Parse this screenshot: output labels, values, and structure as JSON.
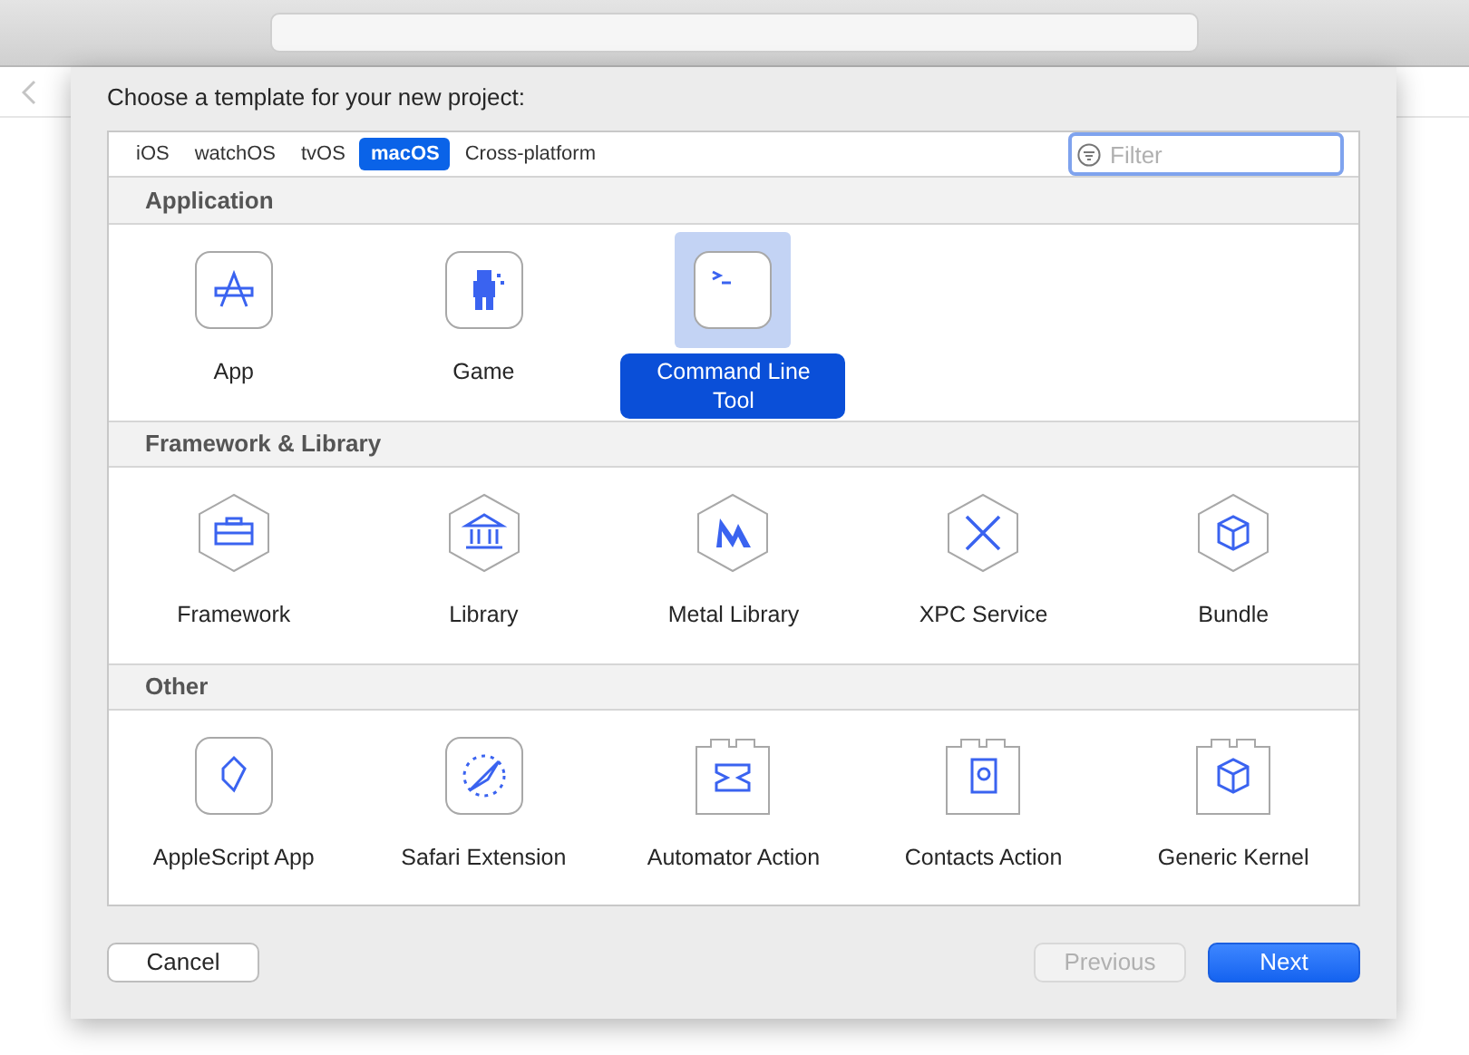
{
  "dialog": {
    "title": "Choose a template for your new project:"
  },
  "tabs": [
    {
      "label": "iOS",
      "selected": false
    },
    {
      "label": "watchOS",
      "selected": false
    },
    {
      "label": "tvOS",
      "selected": false
    },
    {
      "label": "macOS",
      "selected": true
    },
    {
      "label": "Cross-platform",
      "selected": false
    }
  ],
  "filter": {
    "placeholder": "Filter"
  },
  "sections": [
    {
      "title": "Application",
      "items": [
        {
          "label": "App",
          "kind": "rounded",
          "selected": false
        },
        {
          "label": "Game",
          "kind": "rounded",
          "selected": false
        },
        {
          "label": "Command Line Tool",
          "kind": "rounded",
          "selected": true
        }
      ]
    },
    {
      "title": "Framework & Library",
      "items": [
        {
          "label": "Framework",
          "kind": "hexagon",
          "selected": false
        },
        {
          "label": "Library",
          "kind": "hexagon",
          "selected": false
        },
        {
          "label": "Metal Library",
          "kind": "hexagon",
          "selected": false
        },
        {
          "label": "XPC Service",
          "kind": "hexagon",
          "selected": false
        },
        {
          "label": "Bundle",
          "kind": "hexagon",
          "selected": false
        }
      ]
    },
    {
      "title": "Other",
      "items": [
        {
          "label": "AppleScript App",
          "kind": "rounded",
          "selected": false
        },
        {
          "label": "Safari Extension",
          "kind": "rounded",
          "selected": false
        },
        {
          "label": "Automator Action",
          "kind": "block",
          "selected": false
        },
        {
          "label": "Contacts Action",
          "kind": "block",
          "selected": false
        },
        {
          "label": "Generic Kernel",
          "kind": "block",
          "selected": false
        }
      ]
    }
  ],
  "buttons": [
    {
      "label": "Cancel",
      "kind": "normal",
      "disabled": false
    },
    {
      "label": "Previous",
      "kind": "normal",
      "disabled": true
    },
    {
      "label": "Next",
      "kind": "default",
      "disabled": false
    }
  ]
}
